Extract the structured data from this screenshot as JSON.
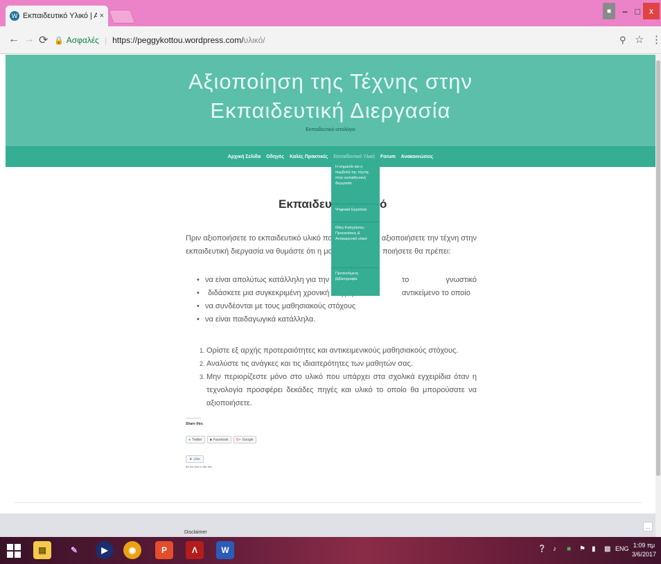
{
  "browser": {
    "tab_title": "Εκπαιδευτικό Υλικό | Αξ",
    "tab_close": "×",
    "secure_label": "Ασφαλές",
    "url_main": "https://peggykottou.wordpress.com/",
    "url_path": "υλικό/",
    "window_controls": {
      "minimize": "–",
      "maximize": "□",
      "close": "x"
    }
  },
  "site": {
    "title_line1": "Αξιοποίηση της Τέχνης στην",
    "title_line2": "Εκπαιδευτική Διεργασία",
    "description": "Εκπαιδευτικό ιστολόγιο"
  },
  "nav": {
    "items": [
      {
        "label": "Αρχική Σελίδα"
      },
      {
        "label": "Οδηγός"
      },
      {
        "label": "Καλές Πρακτικές"
      },
      {
        "label": "Εκπαιδευτικό Υλικό"
      },
      {
        "label": "Forum"
      },
      {
        "label": "Ανακοινώσεις"
      }
    ],
    "dropdown": [
      "Η σημασία και η συμβολή της τέχνης στην εκπαιδευτική διεργασία",
      "Ψηφιακά Εργαλεία",
      "Ιδέες-Εισηγήσεις-Προεκτάσεις & Αντικειμενικό υλικό",
      "Προτεινόμενη βιβλιογραφία"
    ]
  },
  "post": {
    "title_start": "Εκπαιδευτ",
    "title_end": "ό",
    "intro_a": "Πριν αξιοποιήσετε το εκπαιδευτικό υλικό που π",
    "intro_b": "να αξιοποιήσετε την τέχνη στην",
    "intro_c": "εκπαιδευτική διεργασία να θυμάστε ότι η μορφή τέχνη",
    "intro_d": "ποιήσετε θα πρέπει:",
    "bullets": [
      "να είναι απολύτως κατάλληλη για την διδα",
      "το γνωστικό αντικείμενο το οποίο",
      "διδάσκετε μια συγκεκριμένη χρονική στιγμή",
      "να συνδέονται με τους μαθησιακούς στόχους",
      "να είναι παιδαγωγικά κατάλληλα."
    ],
    "steps": [
      {
        "num": "1.",
        "text": "Ορίστε εξ αρχής προτεραιότητες και αντικειμενικούς μαθησιακούς στόχους."
      },
      {
        "num": "2.",
        "text": "Αναλύστε τις ανάγκες και τις ιδιαιτερότητες των μαθητών σας."
      },
      {
        "num": "3.",
        "text": "Μην περιορίζεστε μόνο στο υλικό που υπάρχει στα σχολικά εγχειρίδια όταν η τεχνολογία προσφέρει δεκάδες πηγές και υλικό το οποίο θα μπορούσατε να αξιοποιήσετε."
      }
    ]
  },
  "share": {
    "heading": "Share this:",
    "buttons": [
      "Twitter",
      "Facebook",
      "Google"
    ],
    "like": "Like",
    "like_text": "Be the first to like this."
  },
  "footer": {
    "title": "Disclaimer",
    "button": "..."
  },
  "taskbar": {
    "lang": "ENG",
    "time": "1:09 πμ",
    "date": "3/6/2017"
  }
}
